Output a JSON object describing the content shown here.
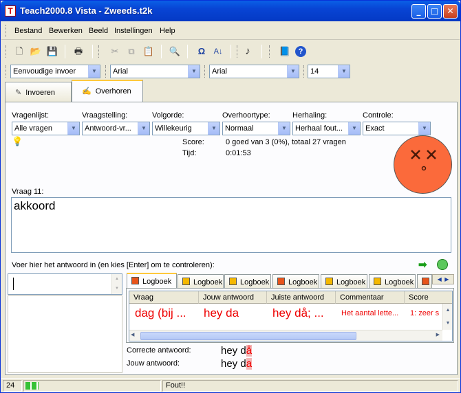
{
  "window": {
    "title": "Teach2000.8 Vista  -  Zweeds.t2k",
    "app_icon": "T",
    "min": "_",
    "max": "□",
    "close": "✕"
  },
  "menu": [
    "Bestand",
    "Bewerken",
    "Beeld",
    "Instellingen",
    "Help"
  ],
  "formatbar": {
    "style": "Eenvoudige invoer",
    "font1": "Arial",
    "font2": "Arial",
    "size": "14"
  },
  "tabs": {
    "invoeren": "Invoeren",
    "overhoren": "Overhoren"
  },
  "options": {
    "vragenlijst": {
      "label": "Vragenlijst:",
      "value": "Alle vragen"
    },
    "vraagstelling": {
      "label": "Vraagstelling:",
      "value": "Antwoord-vr..."
    },
    "volgorde": {
      "label": "Volgorde:",
      "value": "Willekeurig"
    },
    "overhoortype": {
      "label": "Overhoortype:",
      "value": "Normaal"
    },
    "herhaling": {
      "label": "Herhaling:",
      "value": "Herhaal fout..."
    },
    "controle": {
      "label": "Controle:",
      "value": "Exact"
    }
  },
  "score": {
    "label": "Score:",
    "value": "0 goed van 3 (0%), totaal 27 vragen",
    "time_label": "Tijd:",
    "time_value": "0:01:53"
  },
  "question": {
    "label": "Vraag 11:",
    "text": "akkoord"
  },
  "answer_prompt": "Voer hier het antwoord in (en kies [Enter] om te controleren):",
  "answer_input": "",
  "log_tabs": [
    {
      "label": "Logboek",
      "color": "#e8541a"
    },
    {
      "label": "Logboek",
      "color": "#f5b800"
    },
    {
      "label": "Logboek",
      "color": "#f5b800"
    },
    {
      "label": "Logboek",
      "color": "#e8541a"
    },
    {
      "label": "Logboek",
      "color": "#f5b800"
    },
    {
      "label": "Logboek",
      "color": "#f5b800"
    }
  ],
  "log_table": {
    "headers": [
      "Vraag",
      "Jouw antwoord",
      "Juiste antwoord",
      "Commentaar",
      "Score"
    ],
    "row": [
      "dag (bij ...",
      "hey da",
      "hey då; ...",
      "Het aantal lette...",
      "1: zeer s"
    ]
  },
  "feedback": {
    "correct_label": "Correcte antwoord:",
    "correct_ok": "hey d",
    "correct_err": "å",
    "yours_label": "Jouw antwoord:",
    "yours_ok": "hey d",
    "yours_err": "a"
  },
  "status": {
    "count": "24",
    "progress": 0.1,
    "message": "Fout!!"
  },
  "colors": {
    "accent": "#0a5fe6",
    "error": "#ee0000",
    "face": "#fb6a3b",
    "progress": "#36c236"
  }
}
